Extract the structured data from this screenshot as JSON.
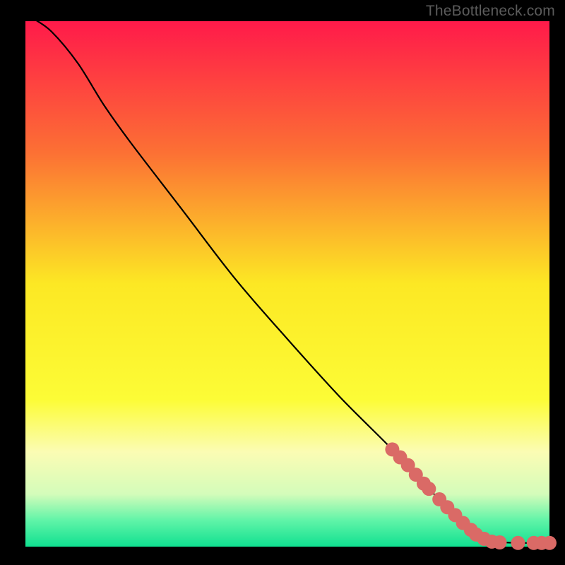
{
  "watermark": "TheBottleneck.com",
  "chart_data": {
    "type": "line",
    "title": "",
    "xlabel": "",
    "ylabel": "",
    "xlim": [
      0,
      100
    ],
    "ylim": [
      0,
      100
    ],
    "gradient": {
      "description": "vertical red-to-yellow-to-green background gradient (bottleneck heatmap)",
      "stops": [
        {
          "offset": 0.0,
          "color": "#ff1a4a"
        },
        {
          "offset": 0.25,
          "color": "#fc7034"
        },
        {
          "offset": 0.5,
          "color": "#fce824"
        },
        {
          "offset": 0.72,
          "color": "#fcfc36"
        },
        {
          "offset": 0.82,
          "color": "#fbfcb4"
        },
        {
          "offset": 0.9,
          "color": "#d4fcba"
        },
        {
          "offset": 0.95,
          "color": "#60f4a8"
        },
        {
          "offset": 1.0,
          "color": "#10e090"
        }
      ]
    },
    "curve": {
      "description": "smooth monotonically-decreasing bottleneck curve",
      "points": [
        {
          "x": 1.5,
          "y": 100.5
        },
        {
          "x": 5,
          "y": 98
        },
        {
          "x": 10,
          "y": 92
        },
        {
          "x": 15,
          "y": 84
        },
        {
          "x": 20,
          "y": 77
        },
        {
          "x": 30,
          "y": 64
        },
        {
          "x": 40,
          "y": 51
        },
        {
          "x": 50,
          "y": 39.5
        },
        {
          "x": 60,
          "y": 28.5
        },
        {
          "x": 70,
          "y": 18.5
        },
        {
          "x": 77,
          "y": 11
        },
        {
          "x": 82,
          "y": 6
        },
        {
          "x": 86,
          "y": 2.5
        },
        {
          "x": 90,
          "y": 0.9
        },
        {
          "x": 100,
          "y": 0.7
        }
      ]
    },
    "markers": {
      "description": "cluster of salmon circular markers along lower-right of curve plus flat tail",
      "color": "#da6a66",
      "radius": 10,
      "points": [
        {
          "x": 70,
          "y": 18.5
        },
        {
          "x": 71.5,
          "y": 17
        },
        {
          "x": 73,
          "y": 15.5
        },
        {
          "x": 74.5,
          "y": 13.7
        },
        {
          "x": 76,
          "y": 12
        },
        {
          "x": 77,
          "y": 11
        },
        {
          "x": 79,
          "y": 9
        },
        {
          "x": 80.5,
          "y": 7.5
        },
        {
          "x": 82,
          "y": 6
        },
        {
          "x": 83.5,
          "y": 4.5
        },
        {
          "x": 85,
          "y": 3.2
        },
        {
          "x": 86,
          "y": 2.3
        },
        {
          "x": 87.5,
          "y": 1.5
        },
        {
          "x": 89,
          "y": 0.95
        },
        {
          "x": 90.5,
          "y": 0.8
        },
        {
          "x": 94,
          "y": 0.7
        },
        {
          "x": 97,
          "y": 0.7
        },
        {
          "x": 98.5,
          "y": 0.7
        },
        {
          "x": 100,
          "y": 0.7
        }
      ]
    }
  }
}
